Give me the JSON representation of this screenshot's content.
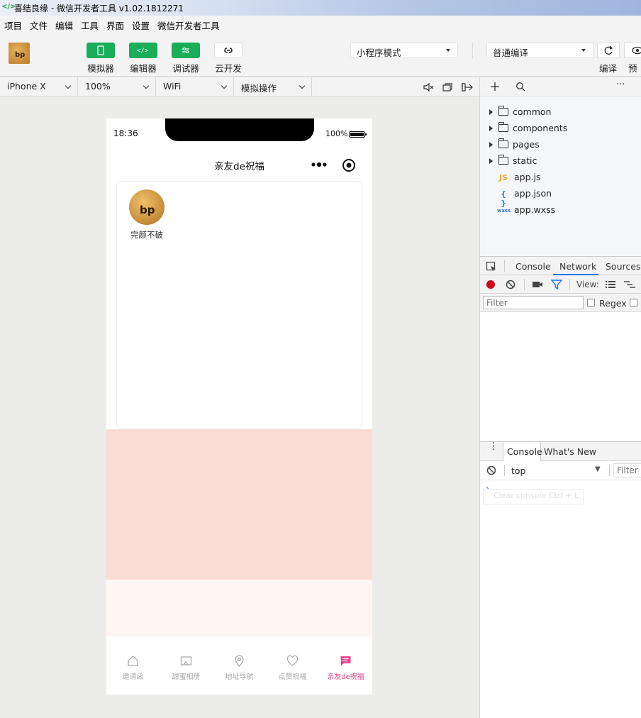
{
  "window": {
    "title": "喜结良缘 - 微信开发者工具 v1.02.1812271"
  },
  "menu": [
    "项目",
    "文件",
    "编辑",
    "工具",
    "界面",
    "设置",
    "微信开发者工具"
  ],
  "toolbar": {
    "buttons": [
      "模拟器",
      "编辑器",
      "调试器",
      "云开发"
    ],
    "mode_select": "小程序模式",
    "compile_select": "普通编译",
    "compile_label": "编译",
    "preview_label": "预览"
  },
  "devbar": {
    "device": "iPhone X",
    "zoom": "100%",
    "network": "WiFi",
    "operation": "模拟操作"
  },
  "phone": {
    "time": "18:36",
    "battery": "100%",
    "nav_title": "亲友de祝福",
    "user_name": "完颜不破",
    "tabs": [
      "邀请函",
      "甜蜜相册",
      "地址导航",
      "点赞祝福",
      "亲友de祝福"
    ],
    "active_tab_color": "#e8488b"
  },
  "filetree": [
    {
      "type": "folder",
      "name": "common"
    },
    {
      "type": "folder",
      "name": "components"
    },
    {
      "type": "folder",
      "name": "pages"
    },
    {
      "type": "folder",
      "name": "static"
    },
    {
      "type": "js",
      "name": "app.js"
    },
    {
      "type": "json",
      "name": "app.json"
    },
    {
      "type": "wxss",
      "name": "app.wxss"
    }
  ],
  "devtools": {
    "tabs": [
      "Console",
      "Network",
      "Sources"
    ],
    "active": "Network",
    "view_label": "View:",
    "filter_placeholder": "Filter",
    "regex_label": "Regex",
    "drawer_tabs": [
      "Console",
      "What's New"
    ],
    "context": "top",
    "console_filter_placeholder": "Filter",
    "console_hint": "Clear console  Ctrl + L"
  }
}
